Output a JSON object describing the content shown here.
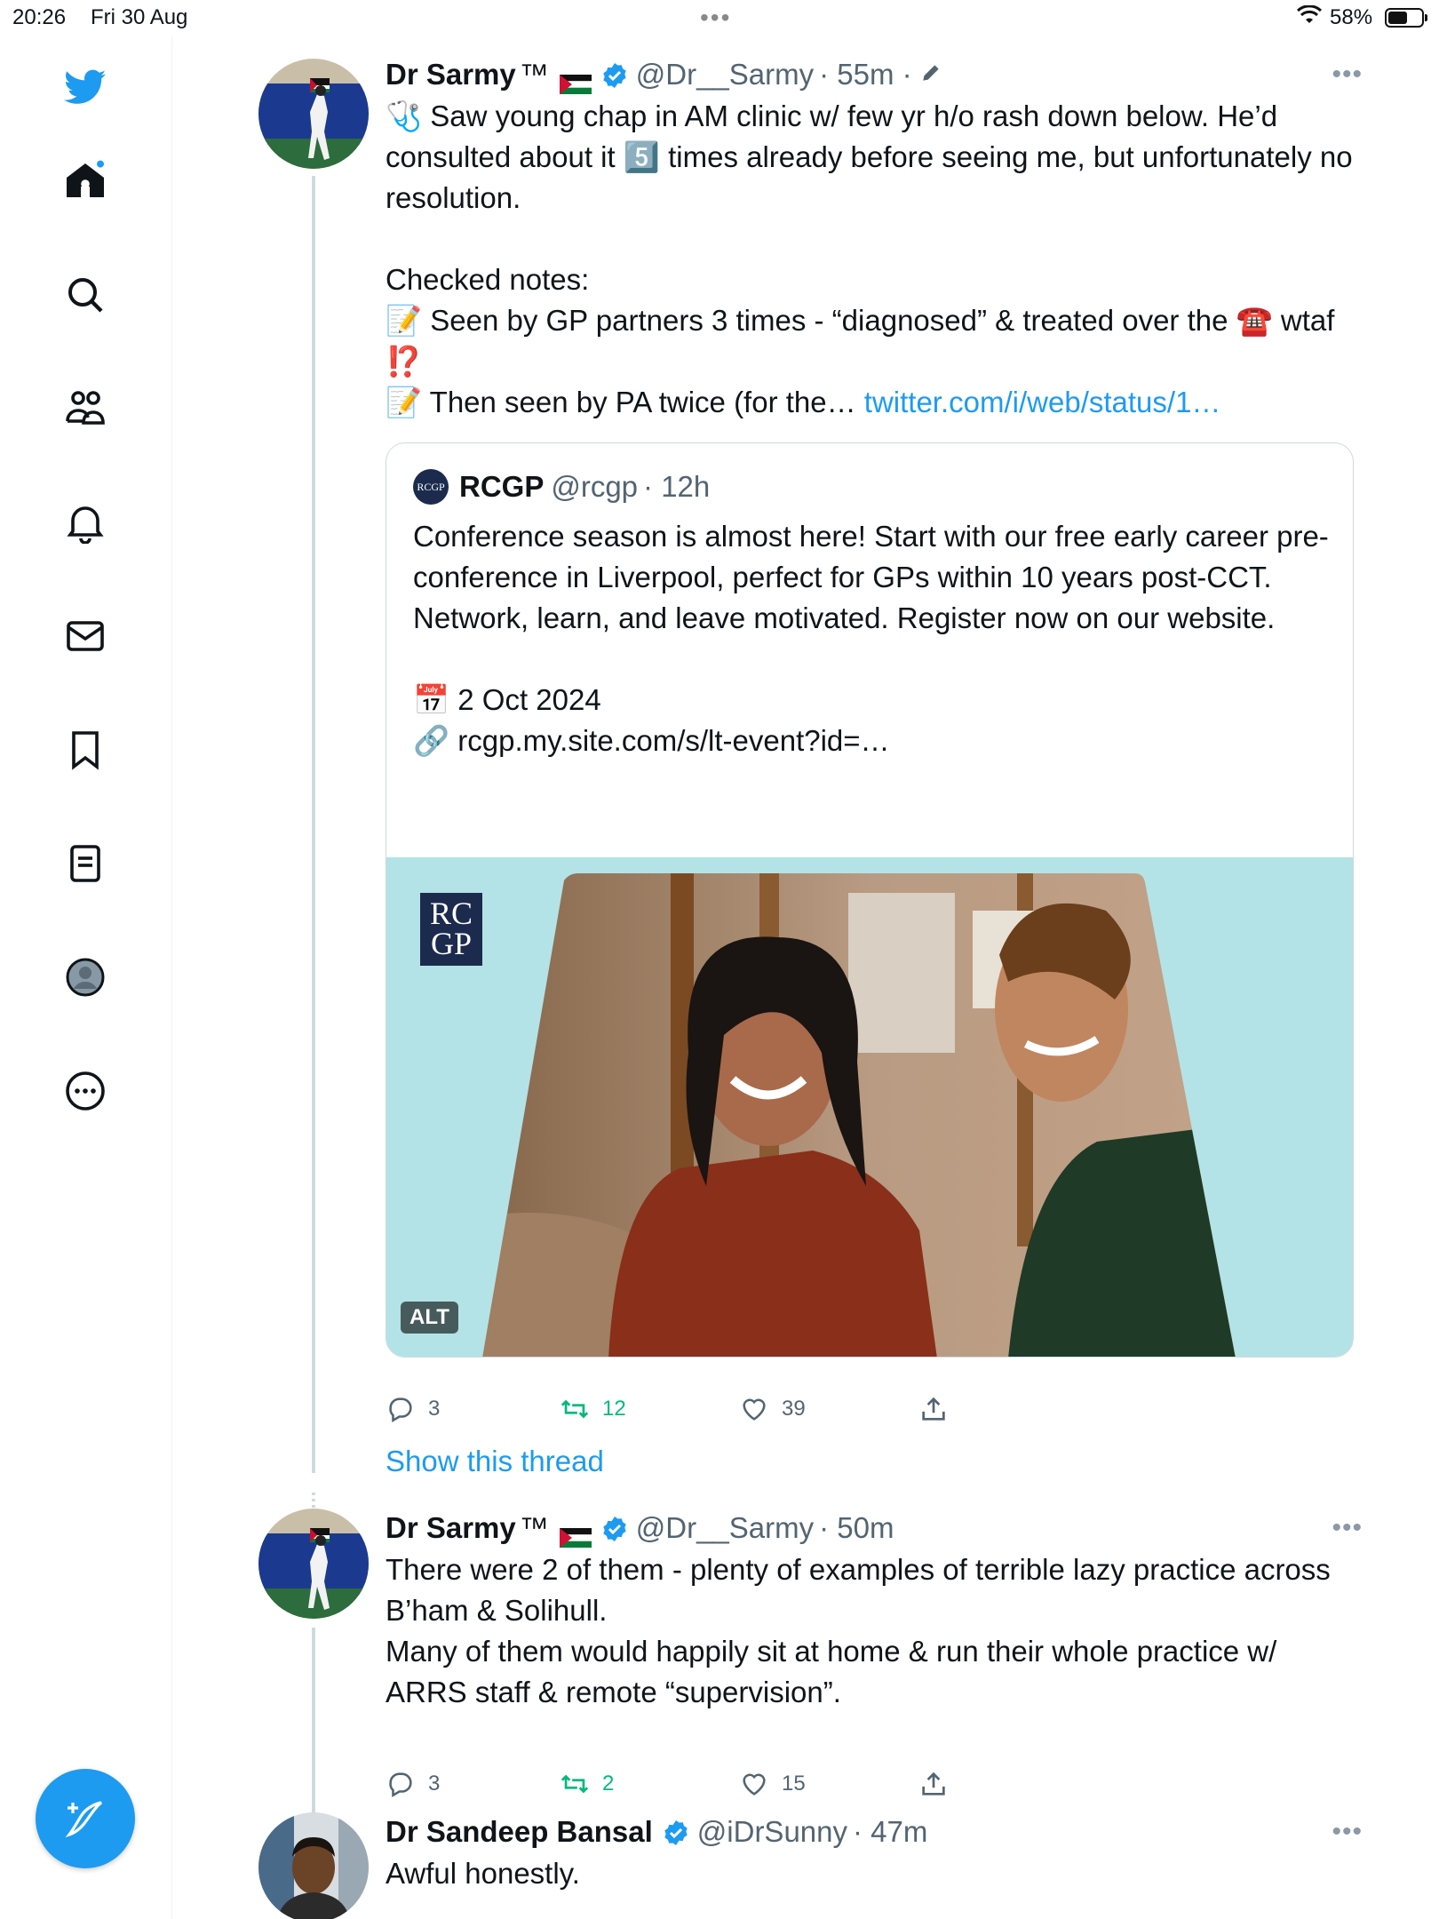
{
  "status_bar": {
    "time": "20:26",
    "date": "Fri 30 Aug",
    "battery_percent": "58%",
    "battery_level": 0.58
  },
  "sidebar": {
    "items": [
      {
        "icon": "twitter-bird-icon"
      },
      {
        "icon": "home-icon",
        "has_notification_dot": true
      },
      {
        "icon": "search-icon"
      },
      {
        "icon": "communities-icon"
      },
      {
        "icon": "notifications-bell-icon"
      },
      {
        "icon": "messages-icon"
      },
      {
        "icon": "bookmarks-icon"
      },
      {
        "icon": "lists-icon"
      },
      {
        "icon": "profile-icon"
      },
      {
        "icon": "more-options-icon"
      }
    ],
    "compose_icon": "compose-tweet-icon"
  },
  "colors": {
    "accent": "#1d9bf0",
    "retweet_green": "#00ba7c",
    "secondary_text": "#536471"
  },
  "tweets": [
    {
      "name": "Dr Sarmy",
      "tm": "™",
      "handle": "@Dr__Sarmy",
      "time": "· 55m ·",
      "text": "🩺 Saw young chap in AM clinic w/ few yr h/o rash down below. He’d consulted about it 5️⃣ times already before seeing me, but unfortunately no resolution.\n\nChecked notes:\n📝 Seen by GP partners 3 times - “diagnosed” & treated over the ☎️ wtaf ⁉️\n📝 Then seen by PA twice (for the… ",
      "link_text": "twitter.com/i/web/status/1…",
      "more": "•••",
      "quote": {
        "name": "RCGP",
        "handle": "@rcgp",
        "time": "· 12h",
        "avatar_text": "RCGP",
        "text": "Conference season is almost here! Start with our free early career pre-conference in Liverpool, perfect for GPs within 10 years post-CCT. Network, learn, and leave motivated. Register now on our website.\n\n📅 2 Oct 2024\n🔗 rcgp.my.site.com/s/lt-event?id=…",
        "media_logo_line1": "RC",
        "media_logo_line2": "GP",
        "alt_label": "ALT"
      },
      "replies": "3",
      "retweets": "12",
      "likes": "39"
    },
    {
      "name": "Dr Sarmy",
      "tm": "™",
      "handle": "@Dr__Sarmy",
      "time": "· 50m",
      "text": "There were 2 of them - plenty of examples of terrible lazy practice across B’ham & Solihull.\nMany of them would happily sit at home & run their whole practice w/ ARRS staff & remote “supervision”.",
      "more": "•••",
      "replies": "3",
      "retweets": "2",
      "likes": "15"
    },
    {
      "name": "Dr Sandeep Bansal",
      "handle": "@iDrSunny",
      "time": "· 47m",
      "text": "Awful honestly.",
      "more": "•••"
    }
  ],
  "show_thread_label": "Show this thread"
}
